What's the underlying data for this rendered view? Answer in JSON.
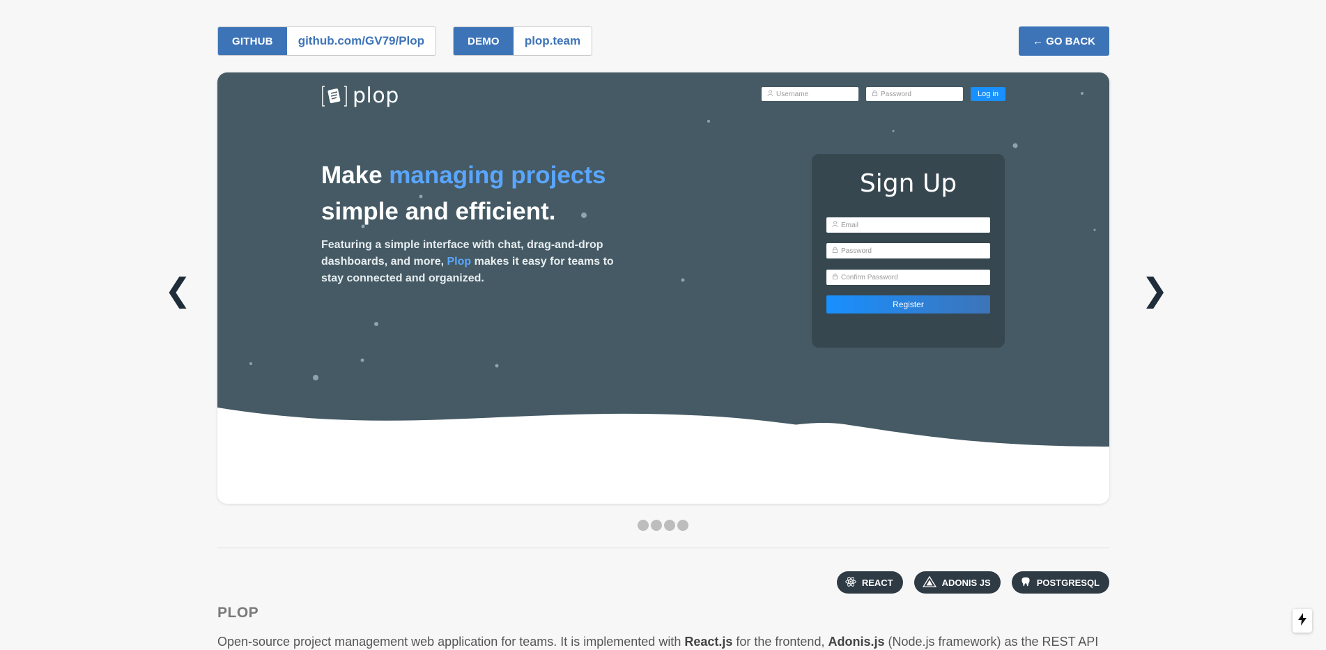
{
  "header": {
    "github": {
      "tag": "GITHUB",
      "url": "github.com/GV79/Plop"
    },
    "demo": {
      "tag": "DEMO",
      "url": "plop.team"
    },
    "go_back": "← GO BACK"
  },
  "carousel": {
    "prev": "❮",
    "next": "❯",
    "slide_count": 4,
    "slide": {
      "brand": "plop",
      "login": {
        "username_placeholder": "Username",
        "password_placeholder": "Password",
        "button": "Log in"
      },
      "headline_plain_1": "Make ",
      "headline_accent": "managing projects",
      "headline_line_2": "simple and efficient.",
      "sub_1": "Featuring a simple interface with chat, drag-and-drop dashboards, and more, ",
      "sub_accent": "Plop",
      "sub_2": " makes it easy for teams to stay connected and organized.",
      "signup": {
        "title": "Sign Up",
        "email_placeholder": "Email",
        "password_placeholder": "Password",
        "confirm_placeholder": "Confirm Password",
        "button": "Register"
      }
    }
  },
  "tech": [
    {
      "label": "REACT",
      "icon": "react-icon"
    },
    {
      "label": "ADONIS JS",
      "icon": "adonis-icon"
    },
    {
      "label": "POSTGRESQL",
      "icon": "postgresql-icon"
    }
  ],
  "project": {
    "title": "PLOP",
    "desc_1": "Open-source project management web application for teams. It is implemented with ",
    "desc_b1": "React.js",
    "desc_2": " for the frontend, ",
    "desc_b2": "Adonis.js",
    "desc_3": " (Node.js framework) as the REST API"
  },
  "colors": {
    "accent": "#3d74b8",
    "hero_bg": "#455a64",
    "card_bg": "#37474f",
    "brand_blue": "#5aa6ff"
  }
}
